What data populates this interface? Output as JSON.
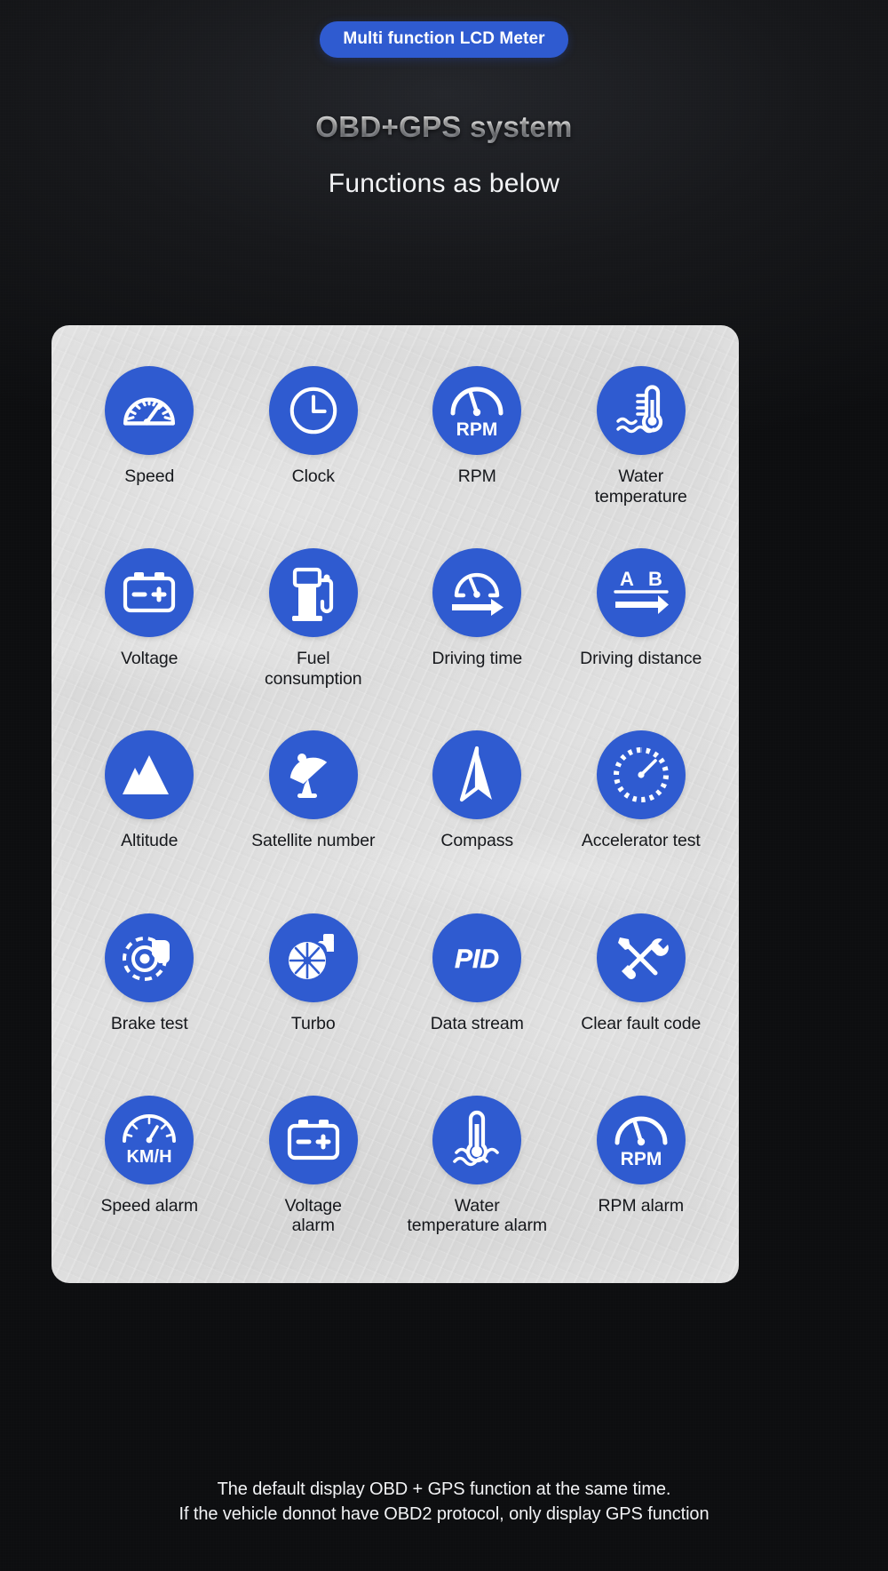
{
  "header": {
    "badge": "Multi function LCD Meter",
    "title": "OBD+GPS system",
    "subtitle": "Functions as below",
    "badge_color": "#2f5bd0"
  },
  "card": {
    "background_color": "#dcdcdc",
    "icon_circle_color": "#2f5bd0",
    "icon_glyph_color": "#ffffff",
    "features": [
      {
        "label": "Speed",
        "icon": "speedometer-icon"
      },
      {
        "label": "Clock",
        "icon": "clock-icon"
      },
      {
        "label": "RPM",
        "icon": "rpm-gauge-icon"
      },
      {
        "label": "Water\ntemperature",
        "icon": "water-temperature-icon"
      },
      {
        "label": "Voltage",
        "icon": "battery-icon"
      },
      {
        "label": "Fuel\nconsumption",
        "icon": "fuel-pump-icon"
      },
      {
        "label": "Driving time",
        "icon": "driving-time-icon"
      },
      {
        "label": "Driving distance",
        "icon": "a-b-distance-icon"
      },
      {
        "label": "Altitude",
        "icon": "mountains-icon"
      },
      {
        "label": "Satellite number",
        "icon": "satellite-dish-icon"
      },
      {
        "label": "Compass",
        "icon": "compass-needle-icon"
      },
      {
        "label": "Accelerator test",
        "icon": "accelerator-gauge-icon"
      },
      {
        "label": "Brake test",
        "icon": "brake-disc-icon"
      },
      {
        "label": "Turbo",
        "icon": "turbo-icon"
      },
      {
        "label": "Data stream",
        "icon": "pid-icon"
      },
      {
        "label": "Clear fault code",
        "icon": "wrench-screwdriver-icon"
      },
      {
        "label": "Speed alarm",
        "icon": "kmh-gauge-icon"
      },
      {
        "label": "Voltage\nalarm",
        "icon": "battery-alarm-icon"
      },
      {
        "label": "Water\ntemperature alarm",
        "icon": "thermometer-water-icon"
      },
      {
        "label": "RPM alarm",
        "icon": "rpm-alarm-gauge-icon"
      }
    ],
    "icon_texts": {
      "rpm": "RPM",
      "ab_a": "A",
      "ab_b": "B",
      "pid": "PID",
      "kmh": "KM/H",
      "rpm_alarm": "RPM"
    }
  },
  "footer": {
    "line1": "The default display OBD + GPS function at the same time.",
    "line2": "If the vehicle donnot have OBD2 protocol, only display GPS function"
  }
}
